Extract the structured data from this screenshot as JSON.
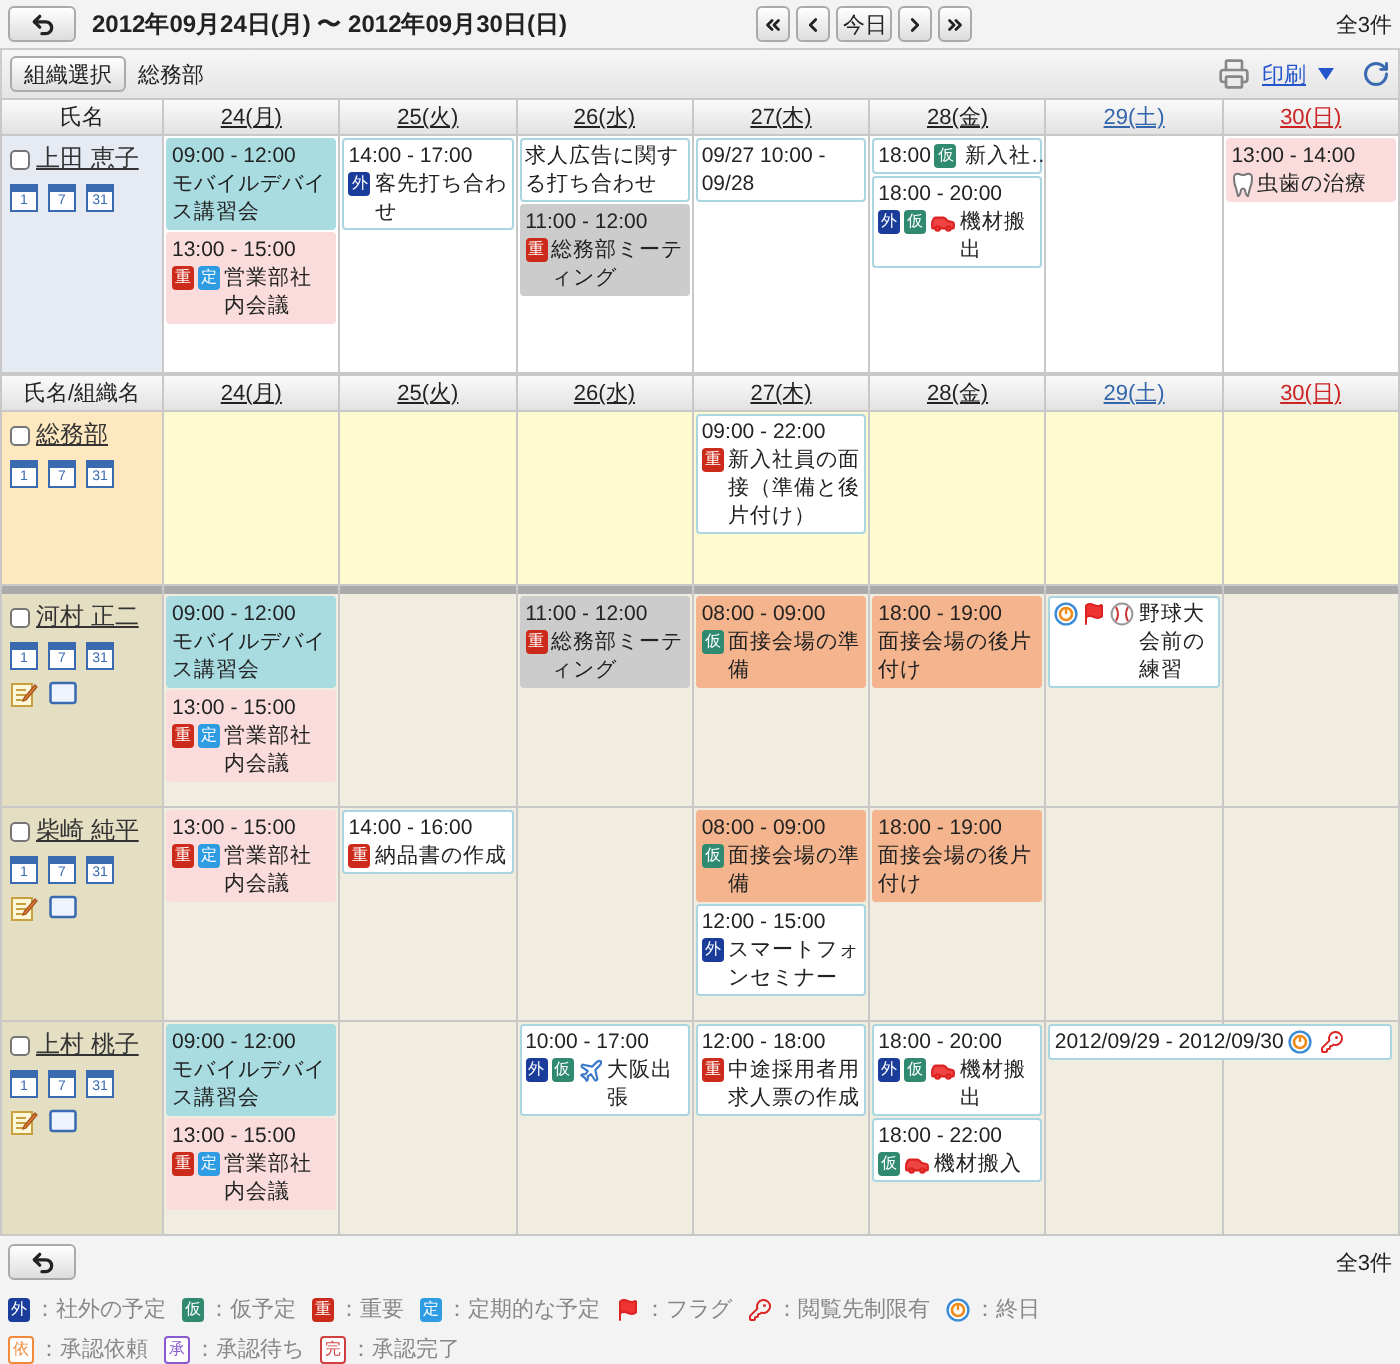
{
  "top": {
    "date_range": "2012年09月24日(月) 〜 2012年09月30日(日)",
    "nav": [
      {
        "kind": "first"
      },
      {
        "kind": "prev"
      },
      {
        "kind": "today",
        "label": "今日"
      },
      {
        "kind": "next"
      },
      {
        "kind": "last"
      }
    ],
    "count": "全3件"
  },
  "toolbar": {
    "org_button": "組織選択",
    "org_name": "総務部",
    "print": "印刷"
  },
  "sections": [
    {
      "name_header": "氏名",
      "days": [
        {
          "label": "24(月)",
          "kind": "weekday"
        },
        {
          "label": "25(火)",
          "kind": "weekday"
        },
        {
          "label": "26(水)",
          "kind": "weekday"
        },
        {
          "label": "27(木)",
          "kind": "weekday"
        },
        {
          "label": "28(金)",
          "kind": "weekday"
        },
        {
          "label": "29(土)",
          "kind": "saturday"
        },
        {
          "label": "30(日)",
          "kind": "sunday"
        }
      ],
      "rows": [
        {
          "kind": "self",
          "name": "上田 恵子",
          "checked": false,
          "views": [
            "1",
            "7",
            "31"
          ],
          "contact_icons": false,
          "cells": [
            [
              {
                "kind": "timed",
                "time": "09:00 - 12:00",
                "title": "モバイルデバイス講習会",
                "color": "#a9dce1"
              },
              {
                "kind": "timed",
                "time": "13:00 - 15:00",
                "title": "営業部社内会議",
                "color": "#fadcdc",
                "marks": [
                  {
                    "kind": "important",
                    "text": "重"
                  },
                  {
                    "kind": "regular",
                    "text": "定"
                  }
                ]
              }
            ],
            [
              {
                "kind": "timed",
                "time": "14:00 - 17:00",
                "title": "客先打ち合わせ",
                "color": "#ffffff",
                "marks": [
                  {
                    "kind": "external",
                    "text": "外"
                  }
                ]
              }
            ],
            [
              {
                "kind": "timed",
                "title": "求人広告に関する打ち合わせ",
                "color": "#ffffff"
              },
              {
                "kind": "timed",
                "time": "11:00 - 12:00",
                "title": "総務部ミーティング",
                "color": "#cccccc",
                "marks": [
                  {
                    "kind": "important",
                    "text": "重"
                  }
                ]
              }
            ],
            [
              {
                "kind": "timed",
                "time": "09/27 10:00 - 09/28",
                "color": "#ffffff"
              }
            ],
            [
              {
                "kind": "compact",
                "time": "18:00",
                "title": "新入社…",
                "color": "#ffffff",
                "marks": [
                  {
                    "kind": "tentative",
                    "text": "仮"
                  }
                ]
              },
              {
                "kind": "timed",
                "time": "18:00 - 20:00",
                "title": "機材搬出",
                "color": "#ffffff",
                "marks": [
                  {
                    "kind": "external",
                    "text": "外"
                  },
                  {
                    "kind": "tentative",
                    "text": "仮"
                  },
                  {
                    "kind": "car"
                  }
                ]
              }
            ],
            [],
            [
              {
                "kind": "timed",
                "time": "13:00 - 14:00",
                "title": "虫歯の治療",
                "color": "#fadcdc",
                "marks": [
                  {
                    "kind": "tooth"
                  }
                ]
              }
            ]
          ]
        }
      ]
    },
    {
      "name_header": "氏名/組織名",
      "days": [
        {
          "label": "24(月)",
          "kind": "weekday"
        },
        {
          "label": "25(火)",
          "kind": "weekday"
        },
        {
          "label": "26(水)",
          "kind": "weekday"
        },
        {
          "label": "27(木)",
          "kind": "weekday"
        },
        {
          "label": "28(金)",
          "kind": "weekday"
        },
        {
          "label": "29(土)",
          "kind": "saturday"
        },
        {
          "label": "30(日)",
          "kind": "sunday"
        }
      ],
      "rows": [
        {
          "kind": "group",
          "name": "総務部",
          "checked": false,
          "views": [
            "1",
            "7",
            "31"
          ],
          "contact_icons": false,
          "cells": [
            [],
            [],
            [],
            [
              {
                "kind": "timed",
                "time": "09:00 - 22:00",
                "title": "新入社員の面接（準備と後片付け）",
                "color": "#ffffff",
                "marks": [
                  {
                    "kind": "important",
                    "text": "重"
                  }
                ]
              }
            ],
            [],
            [],
            []
          ]
        },
        {
          "kind": "member",
          "name": "河村 正二",
          "checked": false,
          "views": [
            "1",
            "7",
            "31"
          ],
          "contact_icons": true,
          "cells": [
            [
              {
                "kind": "timed",
                "time": "09:00 - 12:00",
                "title": "モバイルデバイス講習会",
                "color": "#a9dce1"
              },
              {
                "kind": "timed",
                "time": "13:00 - 15:00",
                "title": "営業部社内会議",
                "color": "#fadcdc",
                "marks": [
                  {
                    "kind": "important",
                    "text": "重"
                  },
                  {
                    "kind": "regular",
                    "text": "定"
                  }
                ]
              }
            ],
            [],
            [
              {
                "kind": "timed",
                "time": "11:00 - 12:00",
                "title": "総務部ミーティング",
                "color": "#cccccc",
                "marks": [
                  {
                    "kind": "important",
                    "text": "重"
                  }
                ]
              }
            ],
            [
              {
                "kind": "timed",
                "time": "08:00 - 09:00",
                "title": "面接会場の準備",
                "color": "#f4b48e",
                "marks": [
                  {
                    "kind": "tentative",
                    "text": "仮"
                  }
                ]
              }
            ],
            [
              {
                "kind": "timed",
                "time": "18:00 - 19:00",
                "title": "面接会場の後片付け",
                "color": "#f4b48e"
              }
            ],
            [
              {
                "kind": "timed",
                "title": "野球大会前の練習",
                "color": "#ffffff",
                "marks": [
                  {
                    "kind": "allday"
                  },
                  {
                    "kind": "flag"
                  },
                  {
                    "kind": "baseball"
                  }
                ]
              }
            ],
            []
          ]
        },
        {
          "kind": "member",
          "name": "柴崎 純平",
          "checked": false,
          "views": [
            "1",
            "7",
            "31"
          ],
          "contact_icons": true,
          "cells": [
            [
              {
                "kind": "timed",
                "time": "13:00 - 15:00",
                "title": "営業部社内会議",
                "color": "#fadcdc",
                "marks": [
                  {
                    "kind": "important",
                    "text": "重"
                  },
                  {
                    "kind": "regular",
                    "text": "定"
                  }
                ]
              }
            ],
            [
              {
                "kind": "timed",
                "time": "14:00 - 16:00",
                "title": "納品書の作成",
                "color": "#ffffff",
                "marks": [
                  {
                    "kind": "important",
                    "text": "重"
                  }
                ]
              }
            ],
            [],
            [
              {
                "kind": "timed",
                "time": "08:00 - 09:00",
                "title": "面接会場の準備",
                "color": "#f4b48e",
                "marks": [
                  {
                    "kind": "tentative",
                    "text": "仮"
                  }
                ]
              },
              {
                "kind": "timed",
                "time": "12:00 - 15:00",
                "title": "スマートフォンセミナー",
                "color": "#ffffff",
                "marks": [
                  {
                    "kind": "external",
                    "text": "外"
                  }
                ]
              }
            ],
            [
              {
                "kind": "timed",
                "time": "18:00 - 19:00",
                "title": "面接会場の後片付け",
                "color": "#f4b48e"
              }
            ],
            [],
            []
          ]
        },
        {
          "kind": "member",
          "name": "上村 桃子",
          "checked": false,
          "views": [
            "1",
            "7",
            "31"
          ],
          "contact_icons": true,
          "cells": [
            [
              {
                "kind": "timed",
                "time": "09:00 - 12:00",
                "title": "モバイルデバイス講習会",
                "color": "#a9dce1"
              },
              {
                "kind": "timed",
                "time": "13:00 - 15:00",
                "title": "営業部社内会議",
                "color": "#fadcdc",
                "marks": [
                  {
                    "kind": "important",
                    "text": "重"
                  },
                  {
                    "kind": "regular",
                    "text": "定"
                  }
                ]
              }
            ],
            [],
            [
              {
                "kind": "timed",
                "time": "10:00 - 17:00",
                "title": "大阪出張",
                "color": "#ffffff",
                "marks": [
                  {
                    "kind": "external",
                    "text": "外"
                  },
                  {
                    "kind": "tentative",
                    "text": "仮"
                  },
                  {
                    "kind": "plane"
                  }
                ]
              }
            ],
            [
              {
                "kind": "timed",
                "time": "12:00 - 18:00",
                "title": "中途採用者用求人票の作成",
                "color": "#ffffff",
                "marks": [
                  {
                    "kind": "important",
                    "text": "重"
                  }
                ]
              }
            ],
            [
              {
                "kind": "timed",
                "time": "18:00 - 20:00",
                "title": "機材搬出",
                "color": "#ffffff",
                "marks": [
                  {
                    "kind": "external",
                    "text": "外"
                  },
                  {
                    "kind": "tentative",
                    "text": "仮"
                  },
                  {
                    "kind": "car"
                  }
                ]
              },
              {
                "kind": "timed",
                "time": "18:00 - 22:00",
                "title": "機材搬入",
                "color": "#ffffff",
                "marks": [
                  {
                    "kind": "tentative",
                    "text": "仮"
                  },
                  {
                    "kind": "car"
                  }
                ]
              }
            ],
            [
              {
                "kind": "multi_day",
                "time": "2012/09/29 - 2012/09/30",
                "color": "#ffffff",
                "marks": [
                  {
                    "kind": "allday"
                  },
                  {
                    "kind": "key"
                  }
                ]
              }
            ],
            []
          ]
        }
      ]
    }
  ],
  "footer": {
    "count": "全3件"
  },
  "legend": [
    [
      {
        "kind": "external",
        "text": "外",
        "label": "：社外の予定"
      },
      {
        "kind": "tentative",
        "text": "仮",
        "label": "：仮予定"
      },
      {
        "kind": "important",
        "text": "重",
        "label": "：重要"
      },
      {
        "kind": "regular",
        "text": "定",
        "label": "：定期的な予定"
      },
      {
        "kind": "flag",
        "label": "：フラグ"
      },
      {
        "kind": "key",
        "label": "：閲覧先制限有"
      },
      {
        "kind": "allday",
        "label": "：終日"
      }
    ],
    [
      {
        "kind": "request",
        "text": "依",
        "label": "：承認依頼"
      },
      {
        "kind": "waiting",
        "text": "承",
        "label": "：承認待ち"
      },
      {
        "kind": "done",
        "text": "完",
        "label": "：承認完了"
      }
    ]
  ]
}
